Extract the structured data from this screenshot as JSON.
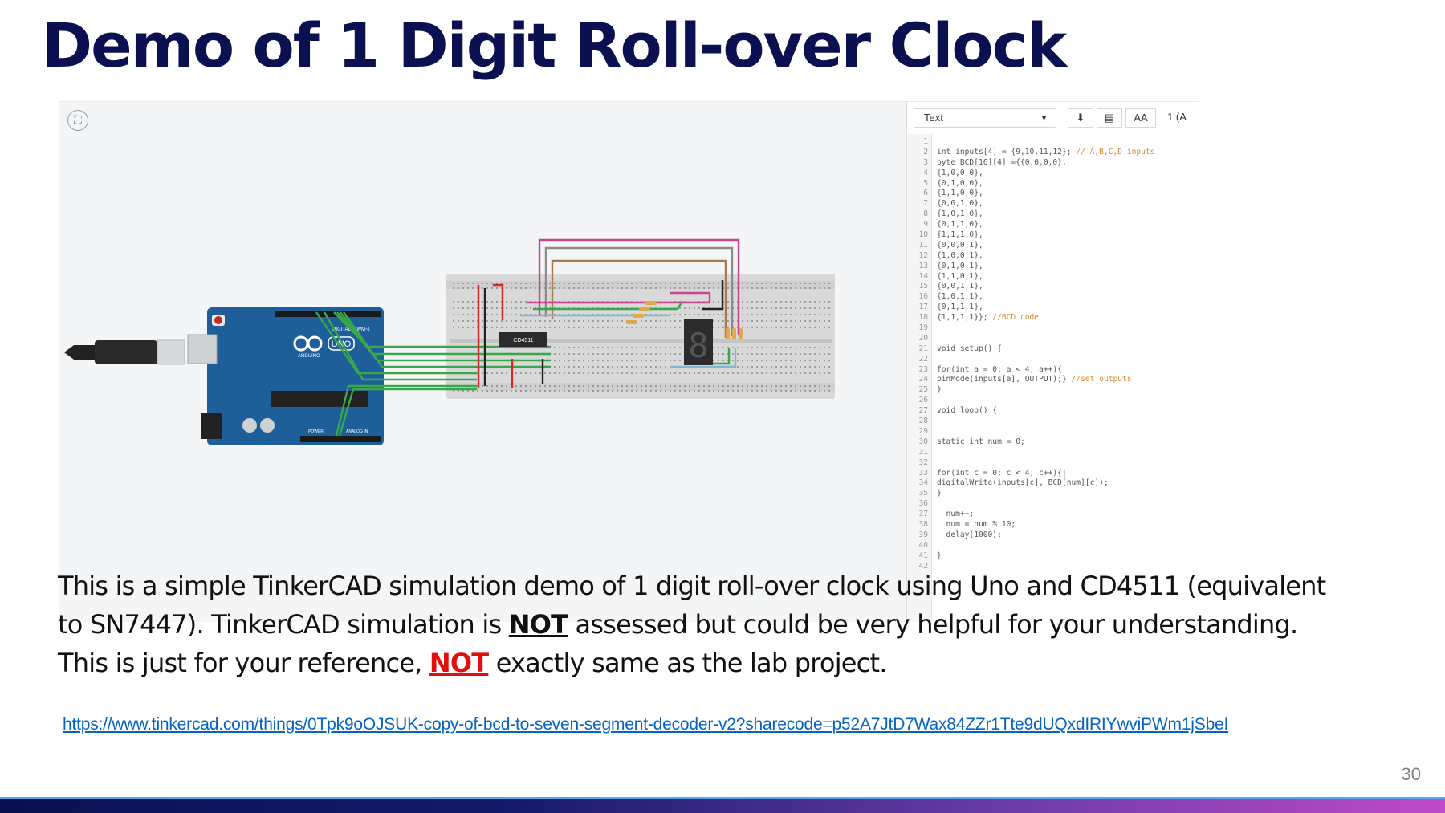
{
  "slide": {
    "title": "Demo of 1 Digit Roll-over Clock",
    "page_number": "30"
  },
  "tinkercad": {
    "board_label": "UNO",
    "board_brand": "ARDUINO",
    "board_header_label": "DIGITAL (PWM~)",
    "board_power_label": "POWER",
    "board_analog_label": "ANALOG IN",
    "chip_label": "CD4511",
    "display_digit": "8",
    "toolbar": {
      "mode": "Text",
      "download_icon": "download-icon",
      "upload_icon": "upload-device-icon",
      "font_size_label": "AA",
      "extra": "1 (A"
    },
    "code_lines": [
      {
        "n": "1",
        "t": "",
        "c": ""
      },
      {
        "n": "2",
        "t": "int inputs[4] = {9,10,11,12}; ",
        "c": "// A,B,C,D inputs"
      },
      {
        "n": "3",
        "t": "byte BCD[16][4] ={{0,0,0,0},",
        "c": ""
      },
      {
        "n": "4",
        "t": "{1,0,0,0},",
        "c": ""
      },
      {
        "n": "5",
        "t": "{0,1,0,0},",
        "c": ""
      },
      {
        "n": "6",
        "t": "{1,1,0,0},",
        "c": ""
      },
      {
        "n": "7",
        "t": "{0,0,1,0},",
        "c": ""
      },
      {
        "n": "8",
        "t": "{1,0,1,0},",
        "c": ""
      },
      {
        "n": "9",
        "t": "{0,1,1,0},",
        "c": ""
      },
      {
        "n": "10",
        "t": "{1,1,1,0},",
        "c": ""
      },
      {
        "n": "11",
        "t": "{0,0,0,1},",
        "c": ""
      },
      {
        "n": "12",
        "t": "{1,0,0,1},",
        "c": ""
      },
      {
        "n": "13",
        "t": "{0,1,0,1},",
        "c": ""
      },
      {
        "n": "14",
        "t": "{1,1,0,1},",
        "c": ""
      },
      {
        "n": "15",
        "t": "{0,0,1,1},",
        "c": ""
      },
      {
        "n": "16",
        "t": "{1,0,1,1},",
        "c": ""
      },
      {
        "n": "17",
        "t": "{0,1,1,1},",
        "c": ""
      },
      {
        "n": "18",
        "t": "{1,1,1,1}}; ",
        "c": "//BCD code"
      },
      {
        "n": "19",
        "t": "",
        "c": ""
      },
      {
        "n": "20",
        "t": "",
        "c": ""
      },
      {
        "n": "21",
        "t": "void setup() {",
        "c": ""
      },
      {
        "n": "22",
        "t": "",
        "c": ""
      },
      {
        "n": "23",
        "t": "for(int a = 0; a < 4; a++){",
        "c": ""
      },
      {
        "n": "24",
        "t": "pinMode(inputs[a], OUTPUT);} ",
        "c": "//set outputs"
      },
      {
        "n": "25",
        "t": "}",
        "c": ""
      },
      {
        "n": "26",
        "t": "",
        "c": ""
      },
      {
        "n": "27",
        "t": "void loop() {",
        "c": ""
      },
      {
        "n": "28",
        "t": "",
        "c": ""
      },
      {
        "n": "29",
        "t": "",
        "c": ""
      },
      {
        "n": "30",
        "t": "static int num = 0;",
        "c": ""
      },
      {
        "n": "31",
        "t": "",
        "c": ""
      },
      {
        "n": "32",
        "t": "",
        "c": ""
      },
      {
        "n": "33",
        "t": "for(int c = 0; c < 4; c++){|",
        "c": ""
      },
      {
        "n": "34",
        "t": "digitalWrite(inputs[c], BCD[num][c]);",
        "c": ""
      },
      {
        "n": "35",
        "t": "}",
        "c": ""
      },
      {
        "n": "36",
        "t": "",
        "c": ""
      },
      {
        "n": "37",
        "t": "  num++;",
        "c": ""
      },
      {
        "n": "38",
        "t": "  num = num % 10;",
        "c": ""
      },
      {
        "n": "39",
        "t": "  delay(1000);",
        "c": ""
      },
      {
        "n": "40",
        "t": "",
        "c": ""
      },
      {
        "n": "41",
        "t": "}",
        "c": ""
      },
      {
        "n": "42",
        "t": "",
        "c": ""
      }
    ]
  },
  "description": {
    "line1": "This is a simple TinkerCAD simulation demo of 1 digit roll-over clock using Uno and CD4511 (equivalent",
    "line2_pre": "to SN7447). TinkerCAD simulation is ",
    "line2_kw": "NOT",
    "line2_post": " assessed but could be very helpful for your understanding.",
    "line3_pre": "This is just for your reference, ",
    "line3_kw": "NOT",
    "line3_post": " exactly same as the lab project."
  },
  "link": {
    "text": "https://www.tinkercad.com/things/0Tpk9oOJSUK-copy-of-bcd-to-seven-segment-decoder-v2?sharecode=p52A7JtD7Wax84ZZr1Tte9dUQxdIRIYwviPWm1jSbeI"
  },
  "colors": {
    "title": "#0b1150",
    "accent_red": "#e01010",
    "link": "#0563c1",
    "board_blue": "#1e5f99",
    "wire_green": "#3aa84a",
    "wire_pink": "#c8458f",
    "wire_grey": "#8c8c8c",
    "wire_brown": "#a9794a",
    "wire_blue": "#7fb6d6"
  }
}
